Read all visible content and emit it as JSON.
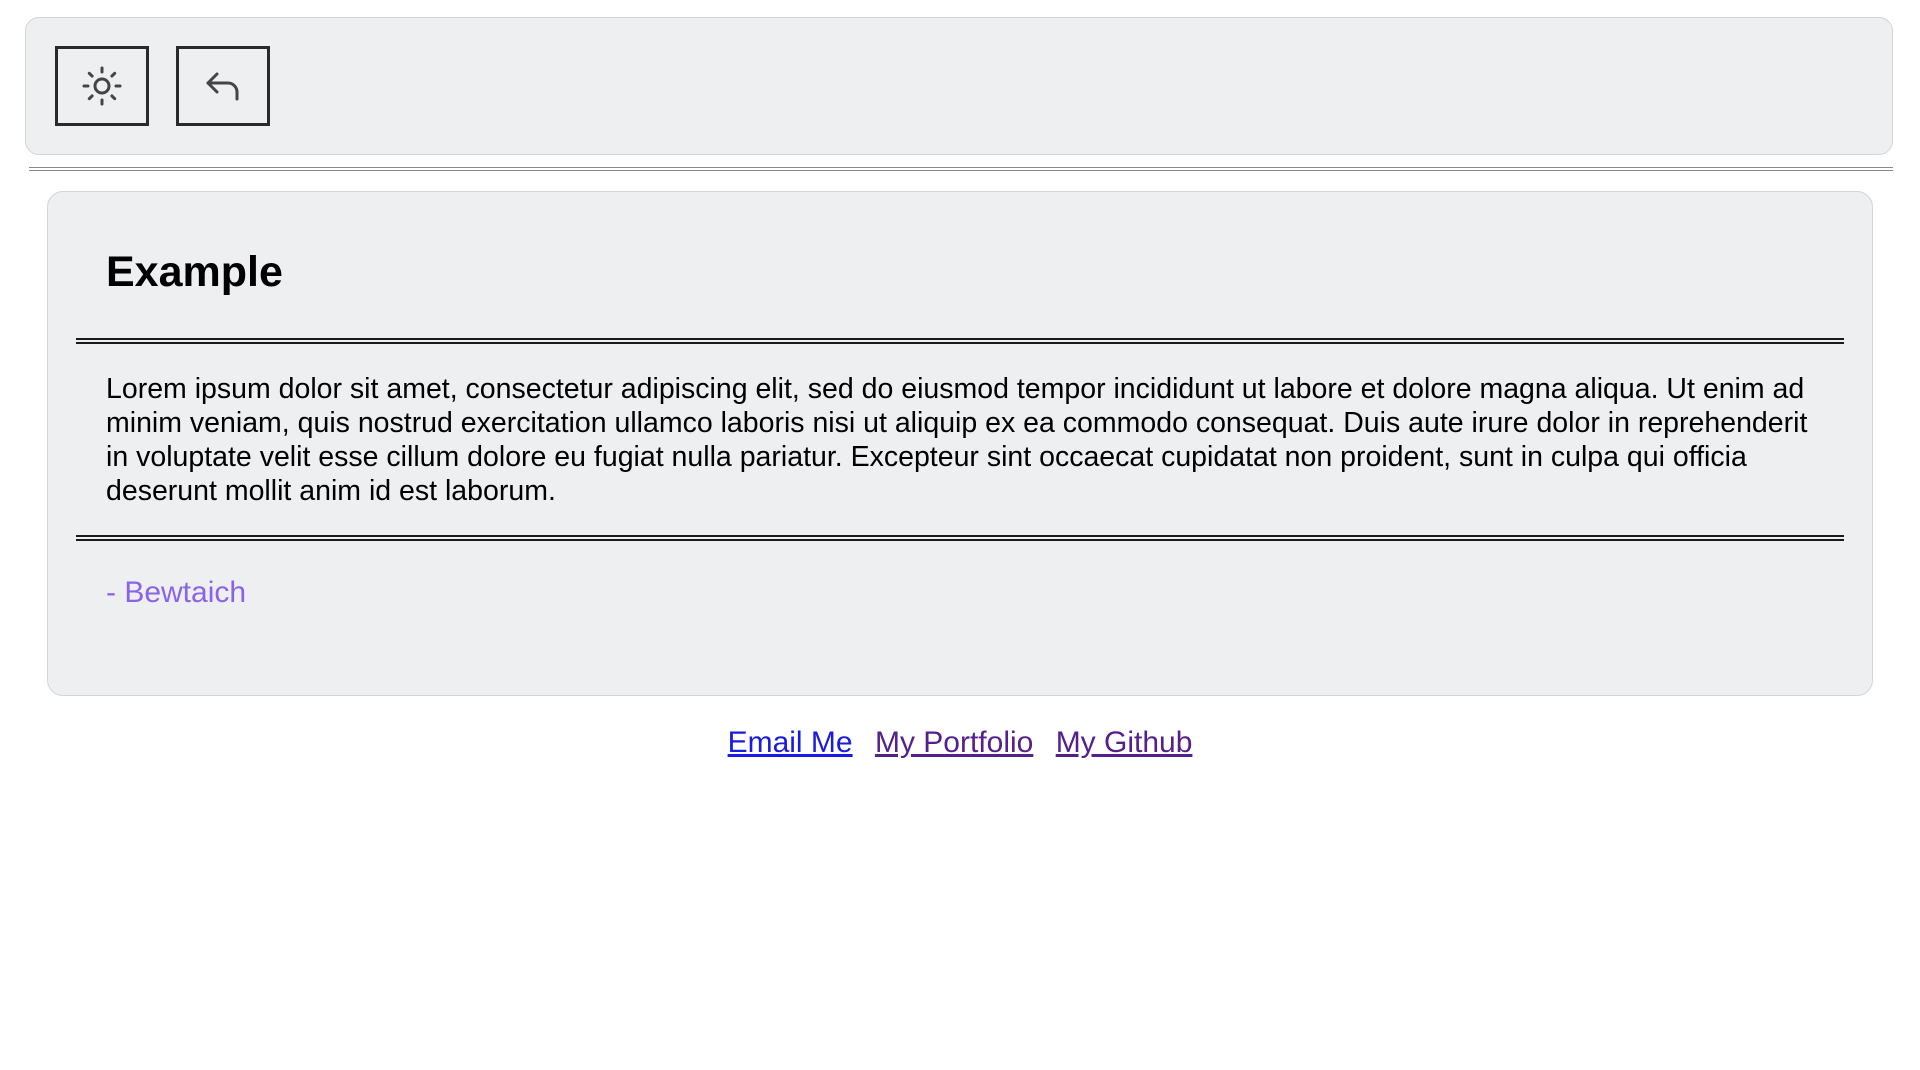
{
  "toolbar": {
    "buttons": [
      {
        "name": "theme-toggle",
        "icon": "sun-icon"
      },
      {
        "name": "back",
        "icon": "undo-arrow-icon"
      }
    ]
  },
  "card": {
    "title": "Example",
    "body": "Lorem ipsum dolor sit amet, consectetur adipiscing elit, sed do eiusmod tempor incididunt ut labore et dolore magna aliqua. Ut enim ad minim veniam, quis nostrud exercitation ullamco laboris nisi ut aliquip ex ea commodo consequat. Duis aute irure dolor in reprehenderit in voluptate velit esse cillum dolore eu fugiat nulla pariatur. Excepteur sint occaecat cupidatat non proident, sunt in culpa qui officia deserunt mollit anim id est laborum.",
    "author": "- Bewtaich"
  },
  "footer": {
    "links": [
      {
        "label": "Email Me"
      },
      {
        "label": "My Portfolio"
      },
      {
        "label": "My Github"
      }
    ]
  },
  "colors": {
    "panel_background": "#eeeff1",
    "author_text": "#8a64e6",
    "link_unvisited": "#1a1ae0",
    "link_visited": "#55208c"
  }
}
